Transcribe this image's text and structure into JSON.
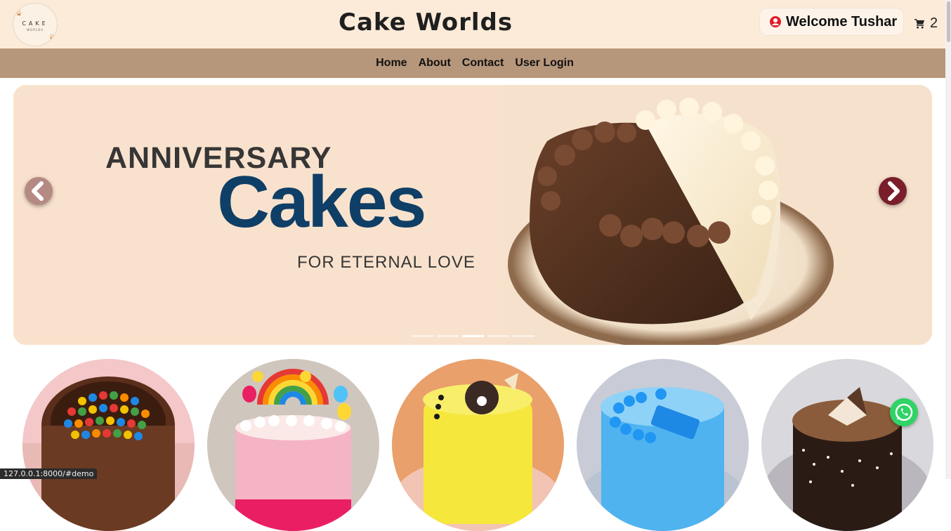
{
  "header": {
    "logo_text": "CAKE",
    "logo_sub": "WORLDS",
    "site_title": "Cake Worlds",
    "welcome_label": "Welcome Tushar",
    "cart_count": "2"
  },
  "nav": {
    "items": [
      {
        "label": "Home"
      },
      {
        "label": "About"
      },
      {
        "label": "Contact"
      },
      {
        "label": "User Login"
      }
    ]
  },
  "carousel": {
    "line1": "ANNIVERSARY",
    "line2": "Cakes",
    "line3": "FOR ETERNAL LOVE",
    "indicator_count": 5,
    "active_index": 2
  },
  "categories": [
    {
      "icon": "gems-cake-image"
    },
    {
      "icon": "rainbow-cake-image"
    },
    {
      "icon": "yellow-cake-image"
    },
    {
      "icon": "blue-dad-cake-image"
    },
    {
      "icon": "chocolate-cake-image"
    }
  ],
  "status_bar": {
    "url": "127.0.0.1:8000/#demo"
  },
  "colors": {
    "header_bg": "#fbebd8",
    "nav_bg": "#b7977b",
    "banner_bg": "#f9e2cd",
    "banner_title": "#0f3f66",
    "whatsapp": "#2fd366"
  }
}
